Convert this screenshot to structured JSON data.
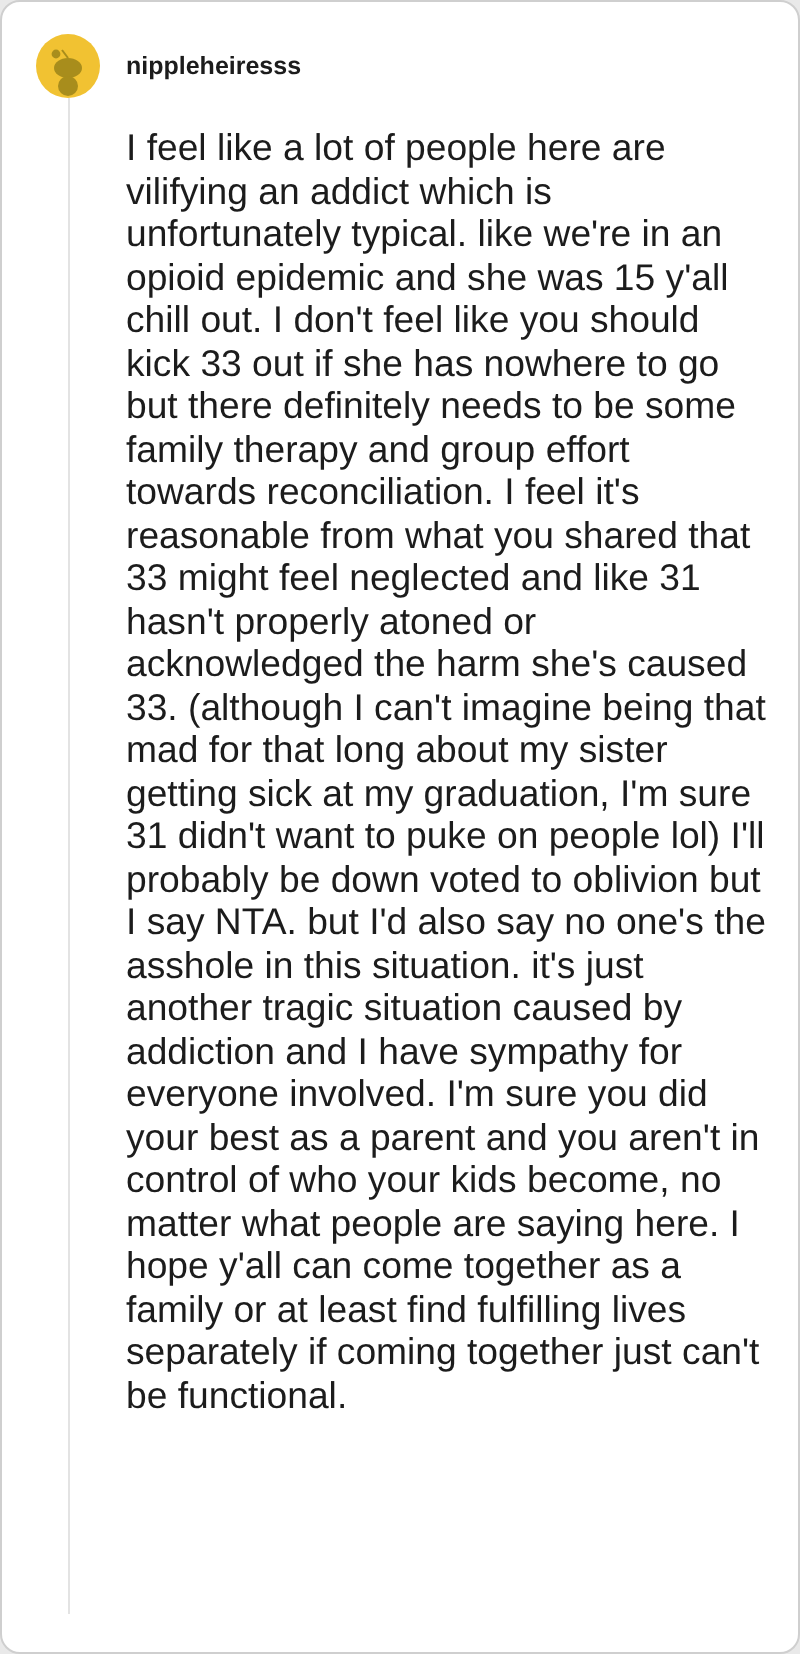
{
  "comment": {
    "author": "nippleheiresss",
    "body": "I feel like a lot of people here are vilifying an addict which is unfortunately typical. like we're in an opioid epidemic and she was 15 y'all chill out. I don't feel like you should kick 33 out if she has nowhere to go but there definitely needs to be some family therapy and group effort towards reconciliation. I feel it's reasonable from what you shared that 33 might feel neglected and like 31 hasn't properly atoned or acknowledged the harm she's caused 33. (although I can't imagine being that mad for that long about my sister getting sick at my graduation, I'm sure 31 didn't want to puke on people lol) I'll probably be down voted to oblivion but I say NTA. but I'd also say no one's the asshole in this situation. it's just another tragic situation caused by addiction and I have sympathy for everyone involved. I'm sure you did your best as a parent and you aren't in control of who your kids become, no matter what people are saying here. I hope y'all can come together as a family or at least find fulfilling lives separately if coming together just can't be functional."
  }
}
